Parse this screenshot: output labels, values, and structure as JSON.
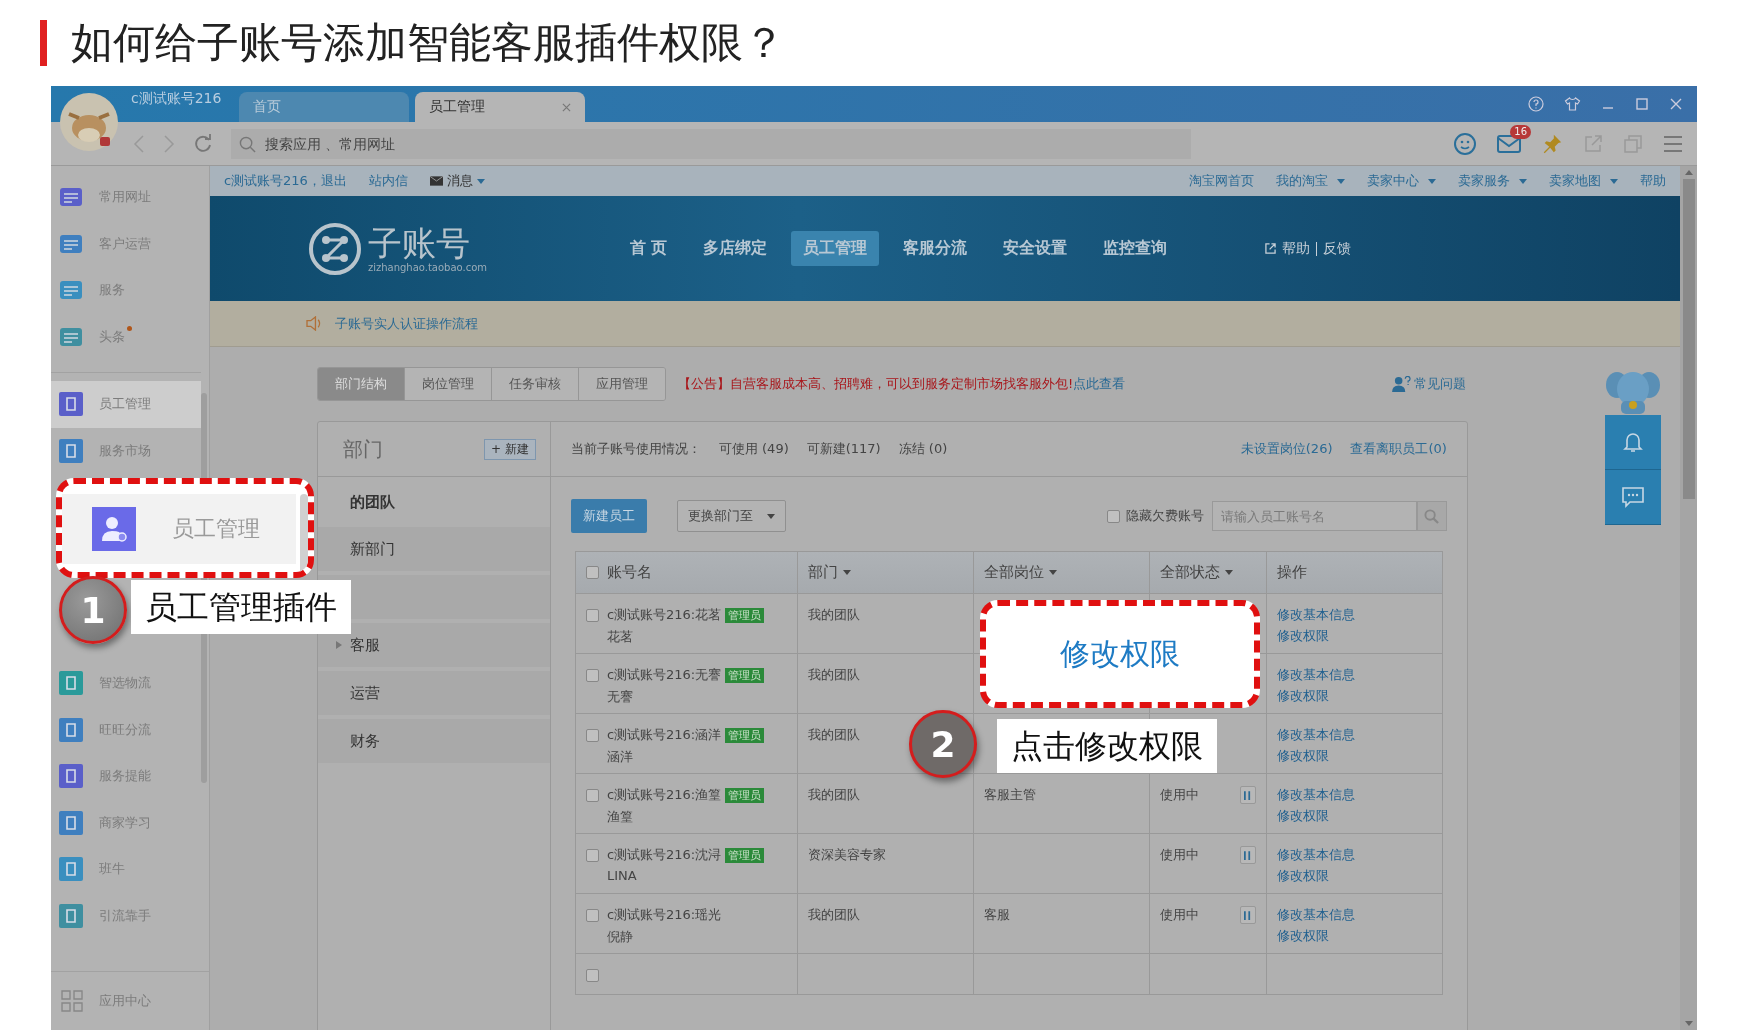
{
  "title": "如何给子账号添加智能客服插件权限？",
  "browser": {
    "account": "c测试账号216",
    "tabs": [
      {
        "label": "首页",
        "selected": false,
        "closable": false
      },
      {
        "label": "员工管理",
        "selected": true,
        "closable": true
      }
    ],
    "search_placeholder": "搜索应用 、常用网址",
    "mail_count": "16"
  },
  "sidebar": {
    "pinned": [
      {
        "label": "常用网址",
        "dot": false
      },
      {
        "label": "客户运营",
        "dot": false
      },
      {
        "label": "服务",
        "dot": false
      },
      {
        "label": "头条",
        "dot": true
      }
    ],
    "plugins": [
      {
        "kind": "item",
        "label": "员工管理",
        "selected": true
      },
      {
        "kind": "item",
        "label": "服务市场",
        "selected": false
      },
      {
        "kind": "covered"
      },
      {
        "kind": "covered"
      },
      {
        "kind": "covered"
      },
      {
        "kind": "covered"
      },
      {
        "kind": "item",
        "label": "智选物流",
        "selected": false
      },
      {
        "kind": "item",
        "label": "旺旺分流",
        "selected": false
      },
      {
        "kind": "item",
        "label": "服务提能",
        "selected": false
      },
      {
        "kind": "item",
        "label": "商家学习",
        "selected": false
      },
      {
        "kind": "item",
        "label": "班牛",
        "selected": false
      },
      {
        "kind": "item",
        "label": "引流靠手",
        "selected": false
      }
    ],
    "footer": "应用中心"
  },
  "site": {
    "user_link": "c测试账号216，退出",
    "inbox": "站内信",
    "messages": "消息",
    "top_links": [
      {
        "label": "淘宝网首页",
        "menu": false
      },
      {
        "label": "我的淘宝",
        "menu": true
      },
      {
        "label": "卖家中心",
        "menu": true
      },
      {
        "label": "卖家服务",
        "menu": true
      },
      {
        "label": "卖家地图",
        "menu": true
      },
      {
        "label": "帮助",
        "menu": false
      }
    ],
    "logo": "子账号",
    "domain": "zizhanghao.taobao.com",
    "nav": [
      {
        "label": "首 页",
        "selected": false
      },
      {
        "label": "多店绑定",
        "selected": false
      },
      {
        "label": "员工管理",
        "selected": true
      },
      {
        "label": "客服分流",
        "selected": false
      },
      {
        "label": "安全设置",
        "selected": false
      },
      {
        "label": "监控查询",
        "selected": false
      }
    ],
    "help": "帮助",
    "feedback": "反馈",
    "notice": "子账号实人认证操作流程"
  },
  "tabs": [
    {
      "label": "部门结构",
      "selected": true
    },
    {
      "label": "岗位管理",
      "selected": false
    },
    {
      "label": "任务审核",
      "selected": false
    },
    {
      "label": "应用管理",
      "selected": false
    }
  ],
  "announcement": {
    "text": "【公告】自营客服成本高、招聘难，可以到服务定制市场找客服外包!",
    "link": "点此查看"
  },
  "faq": "常见问题",
  "dept": {
    "title": "部门",
    "new_button": "+ 新建",
    "items": [
      {
        "kind": "root",
        "label": "的团队"
      },
      {
        "kind": "leaf",
        "label": "新部门"
      },
      {
        "kind": "covered"
      },
      {
        "kind": "group",
        "label": "客服"
      },
      {
        "kind": "leaf",
        "label": "运营"
      },
      {
        "kind": "leaf",
        "label": "财务"
      }
    ]
  },
  "usage": {
    "label": "当前子账号使用情况：",
    "stats": [
      "可使用 (49)",
      "可新建(117)",
      "冻结 (0)"
    ],
    "links": [
      "未设置岗位(26)",
      "查看离职员工(0)"
    ]
  },
  "toolbar": {
    "new_button": "新建员工",
    "move_dropdown": "更换部门至",
    "hide_arrears": {
      "label": "隐藏欠费账号",
      "checked": false
    },
    "search_placeholder": "请输入员工账号名"
  },
  "table": {
    "select_all": false,
    "columns": [
      {
        "label": "账号名",
        "menu": false
      },
      {
        "label": "部门",
        "menu": true
      },
      {
        "label": "全部岗位",
        "menu": true
      },
      {
        "label": "全部状态",
        "menu": true
      },
      {
        "label": "操作",
        "menu": false
      }
    ],
    "rows": [
      {
        "kind": "full",
        "checked": false,
        "account": "c测试账号216:花茗",
        "badge": "管理员",
        "name": "花茗",
        "dept": "我的团队",
        "actions": [
          "修改基本信息",
          "修改权限"
        ]
      },
      {
        "kind": "full",
        "checked": false,
        "account": "c测试账号216:无謇",
        "badge": "管理员",
        "name": "无謇",
        "dept": "我的团队",
        "actions": [
          "修改基本信息",
          "修改权限"
        ]
      },
      {
        "kind": "full",
        "checked": false,
        "account": "c测试账号216:涵洋",
        "badge": "管理员",
        "name": "涵洋",
        "dept": "我的团队",
        "actions": [
          "修改基本信息",
          "修改权限"
        ]
      },
      {
        "kind": "full",
        "checked": false,
        "account": "c测试账号216:渔篁",
        "badge": "管理员",
        "name": "渔篁",
        "dept": "我的团队",
        "position": "客服主管",
        "status": "使用中",
        "actions": [
          "修改基本信息",
          "修改权限"
        ]
      },
      {
        "kind": "full",
        "checked": false,
        "account": "c测试账号216:沈浔",
        "badge": "管理员",
        "name": "LINA",
        "dept": "资深美容专家",
        "status": "使用中",
        "actions": [
          "修改基本信息",
          "修改权限"
        ]
      },
      {
        "kind": "full",
        "checked": false,
        "account": "c测试账号216:瑶光",
        "name": "倪静",
        "dept": "我的团队",
        "position": "客服",
        "status": "使用中",
        "actions": [
          "修改基本信息",
          "修改权限"
        ]
      },
      {
        "kind": "cut",
        "checked": false
      }
    ]
  },
  "callouts": [
    {
      "kind": "menu",
      "number": "1",
      "label": "员工管理插件",
      "zoom_text": "员工管理"
    },
    {
      "kind": "link",
      "number": "2",
      "label": "点击修改权限",
      "zoom_text": "修改权限"
    }
  ]
}
